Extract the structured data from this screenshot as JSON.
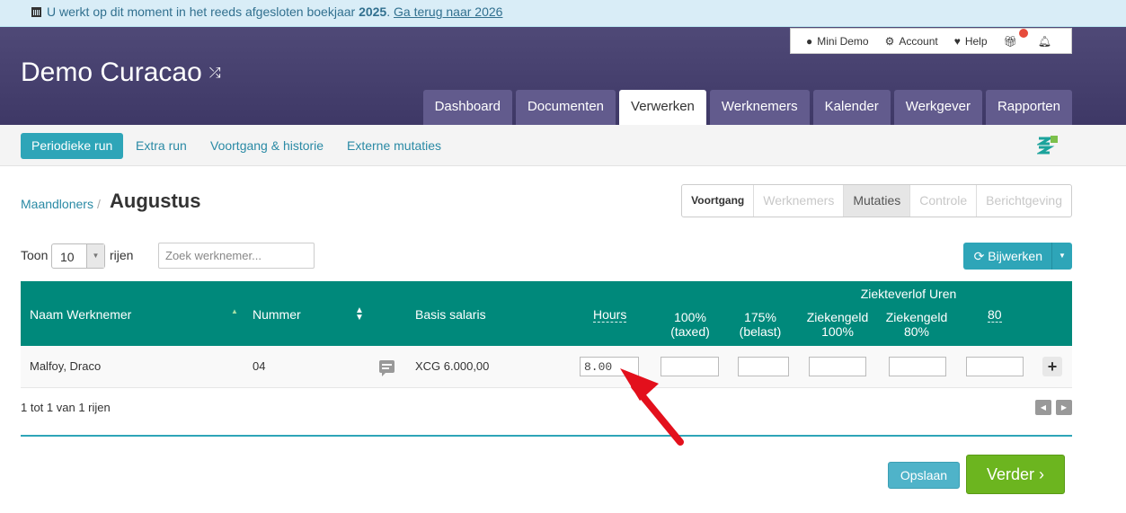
{
  "notice": {
    "prefix": "U werkt op dit moment in het reeds afgesloten boekjaar",
    "year": "2025",
    "link": "Ga terug naar 2026"
  },
  "brand": {
    "name": "Demo Curacao",
    "switch_icon": "shuffle-icon"
  },
  "topbar": {
    "user": "Mini Demo",
    "account": "Account",
    "help": "Help"
  },
  "tabs": [
    "Dashboard",
    "Documenten",
    "Verwerken",
    "Werknemers",
    "Kalender",
    "Werkgever",
    "Rapporten"
  ],
  "active_tab": "Verwerken",
  "subnav": [
    "Periodieke run",
    "Extra run",
    "Voortgang & historie",
    "Externe mutaties"
  ],
  "breadcrumb": {
    "parent": "Maandloners",
    "separator": "/",
    "current": "Augustus"
  },
  "steps": [
    "Voortgang",
    "Werknemers",
    "Mutaties",
    "Controle",
    "Berichtgeving"
  ],
  "active_step": "Mutaties",
  "toolbar": {
    "show_label": "Toon",
    "page_size": "10",
    "rows_label": "rijen",
    "search_placeholder": "Zoek werknemer...",
    "update_button": "Bijwerken"
  },
  "table": {
    "group_header": "Ziekteverlof Uren",
    "columns": {
      "name": "Naam Werknemer",
      "number": "Nummer",
      "base_salary": "Basis salaris",
      "hours": "Hours",
      "c100_line1": "100%",
      "c100_line2": "(taxed)",
      "c175_line1": "175%",
      "c175_line2": "(belast)",
      "sick100_line1": "Ziekengeld",
      "sick100_line2": "100%",
      "sick80_line1": "Ziekengeld",
      "sick80_line2": "80%",
      "c80": "80"
    },
    "rows": [
      {
        "name": "Malfoy, Draco",
        "number": "04",
        "base_salary": "XCG 6.000,00",
        "hours": "8.00",
        "c100": "",
        "c175": "",
        "sick100": "",
        "sick80": "",
        "c80": ""
      }
    ]
  },
  "pagination": {
    "info": "1 tot 1 van 1 rijen"
  },
  "actions": {
    "save": "Opslaan",
    "next": "Verder"
  },
  "colors": {
    "header": "#4f4977",
    "table_header": "#00897b",
    "accent": "#2ea5b8",
    "next": "#6cb51f",
    "annotation_arrow": "#e3101c"
  }
}
